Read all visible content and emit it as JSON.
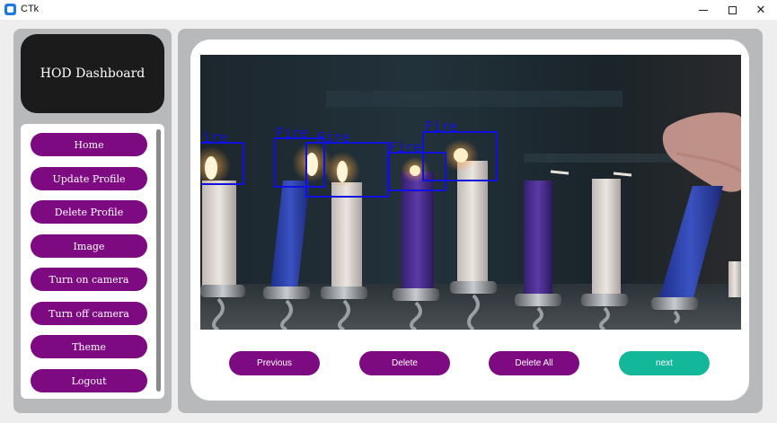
{
  "window": {
    "title": "CTk",
    "minimize_icon": "minimize-icon",
    "maximize_icon": "maximize-icon",
    "close_icon": "close-icon",
    "close_glyph": "✕"
  },
  "sidebar": {
    "header_title": "HOD Dashboard",
    "menu": [
      {
        "label": "Home"
      },
      {
        "label": "Update Profile"
      },
      {
        "label": "Delete Profile"
      },
      {
        "label": "Image"
      },
      {
        "label": "Turn on camera"
      },
      {
        "label": "Turn off camera"
      },
      {
        "label": "Theme"
      },
      {
        "label": "Logout"
      }
    ]
  },
  "viewer": {
    "detections": [
      {
        "label": "Fire"
      },
      {
        "label": "Fire"
      },
      {
        "label": "Fire"
      },
      {
        "label": "Fire"
      },
      {
        "label": "Fire"
      }
    ]
  },
  "actions": {
    "previous": "Previous",
    "delete": "Delete",
    "delete_all": "Delete All",
    "next": "next"
  },
  "colors": {
    "menu_button": "#7e0a82",
    "next_button": "#13b89a",
    "detection_box": "#1010e0",
    "header_bg": "#1b1b1b",
    "panel_bg": "#b7b9ba"
  }
}
